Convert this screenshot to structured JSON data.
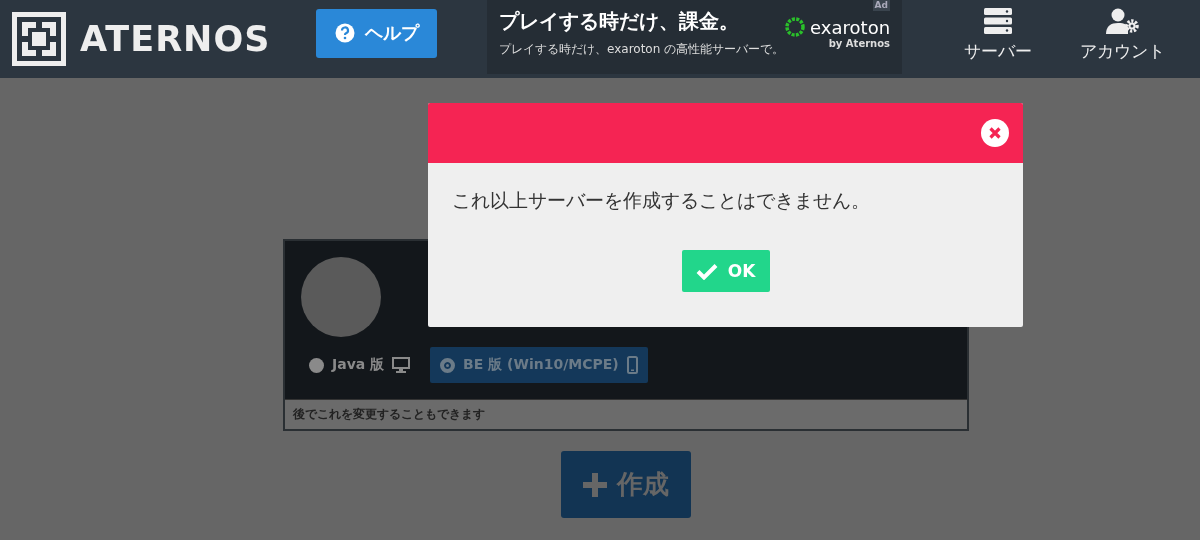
{
  "header": {
    "logo_text": "ATERNOS",
    "help_button": "ヘルプ",
    "ad": {
      "headline": "プレイする時だけ、課金。",
      "subline": "プレイする時だけ、exaroton の高性能サーバーで。",
      "brand": "exaroton",
      "brand_sub": "by Aternos",
      "badge": "Ad"
    },
    "nav": [
      {
        "kind": "servers",
        "label": "サーバー"
      },
      {
        "kind": "account",
        "label": "アカウント"
      }
    ]
  },
  "server_form": {
    "editions": [
      {
        "label": "Java 版",
        "kind": "desktop",
        "selected": false
      },
      {
        "label": "BE 版 (Win10/MCPE)",
        "kind": "mobile",
        "selected": true
      }
    ],
    "note": "後でこれを変更することもできます",
    "create_button": "作成"
  },
  "dialog": {
    "message": "これ以上サーバーを作成することはできません。",
    "ok_button": "OK"
  }
}
